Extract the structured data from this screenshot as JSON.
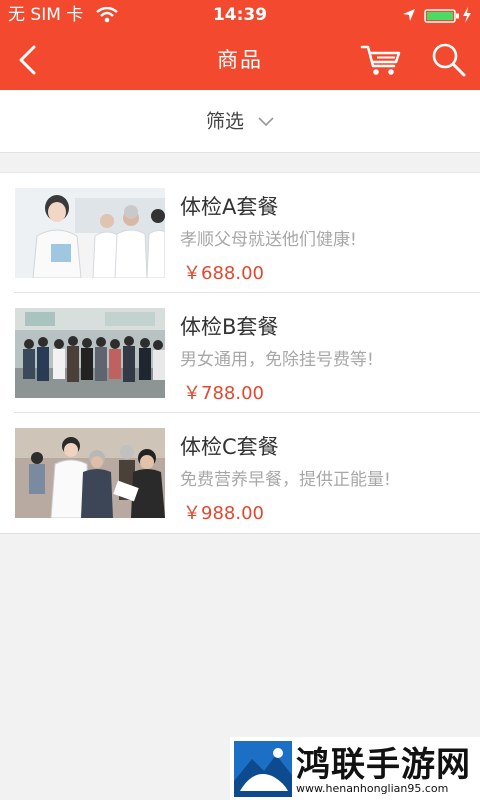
{
  "status_bar": {
    "carrier": "无 SIM 卡",
    "time": "14:39"
  },
  "nav": {
    "title": "商品",
    "icons": [
      "back-icon",
      "cart-icon",
      "search-icon"
    ]
  },
  "filter": {
    "label": "筛选",
    "icon": "chevron-down-icon"
  },
  "products": [
    {
      "name": "体检A套餐",
      "desc": "孝顺父母就送他们健康!",
      "price": "￥688.00"
    },
    {
      "name": "体检B套餐",
      "desc": "男女通用，免除挂号费等!",
      "price": "￥788.00"
    },
    {
      "name": "体检C套餐",
      "desc": "免费营养早餐，提供正能量!",
      "price": "￥988.00"
    }
  ],
  "watermark": {
    "name": "鸿联手游网",
    "url": "www.henanhonglian95.com"
  },
  "colors": {
    "header": "#f2492f",
    "price": "#e5472e",
    "background": "#f2f2f2"
  }
}
